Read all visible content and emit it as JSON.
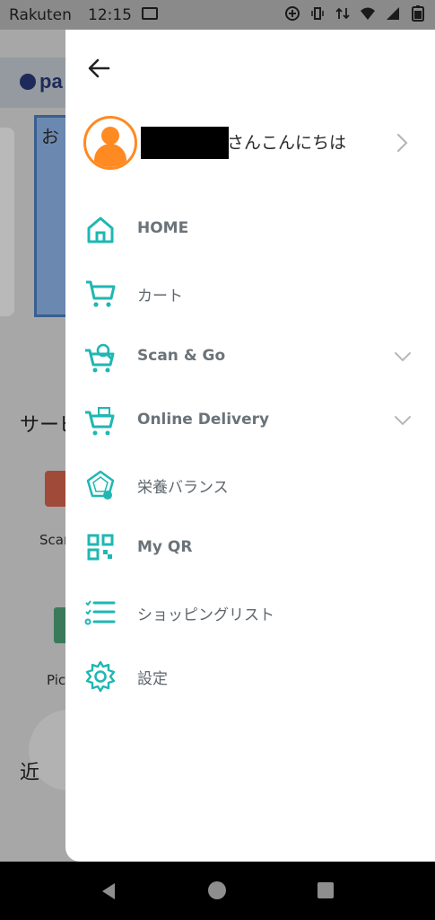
{
  "status_bar": {
    "carrier": "Rakuten",
    "time": "12:15"
  },
  "background": {
    "logo_text": "pa",
    "banner_text": "お",
    "section_title": "サービ",
    "service1_label": "Scar",
    "service2_label": "Pic",
    "near_label": "近"
  },
  "drawer": {
    "greeting": "さんこんにちは",
    "menu": [
      {
        "label": "HOME",
        "icon": "home-icon",
        "has_chevron": false
      },
      {
        "label": "カート",
        "icon": "cart-icon",
        "has_chevron": false
      },
      {
        "label": "Scan & Go",
        "icon": "scan-go-icon",
        "has_chevron": true
      },
      {
        "label": "Online Delivery",
        "icon": "online-delivery-icon",
        "has_chevron": true
      },
      {
        "label": "栄養バランス",
        "icon": "nutrition-balance-icon",
        "has_chevron": false
      },
      {
        "label": "My QR",
        "icon": "qr-code-icon",
        "has_chevron": false
      },
      {
        "label": "ショッピングリスト",
        "icon": "shopping-list-icon",
        "has_chevron": false
      },
      {
        "label": "設定",
        "icon": "gear-icon",
        "has_chevron": false
      }
    ]
  },
  "colors": {
    "accent": "#1fb7b3",
    "avatar": "#ff8a21",
    "label": "#6b7379"
  }
}
